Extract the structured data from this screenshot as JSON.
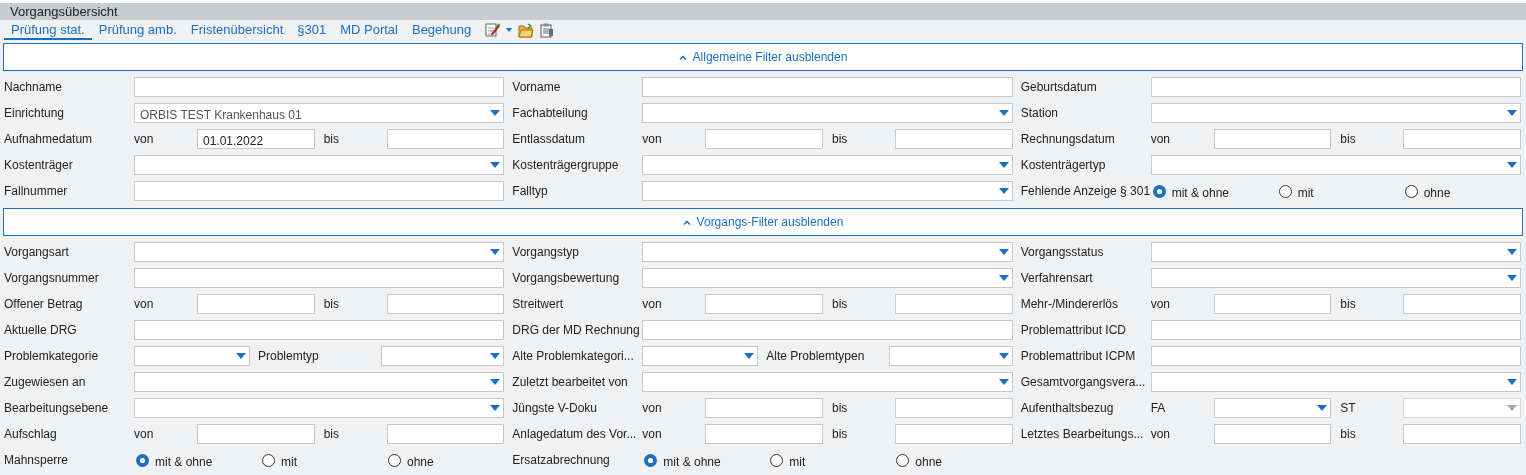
{
  "window": {
    "title": "Vorgangsübersicht"
  },
  "tabs": [
    {
      "label": "Prüfung stat.",
      "selected": true
    },
    {
      "label": "Prüfung amb.",
      "selected": false
    },
    {
      "label": "Fristenübersicht",
      "selected": false
    },
    {
      "label": "§301",
      "selected": false
    },
    {
      "label": "MD Portal",
      "selected": false
    },
    {
      "label": "Begehung",
      "selected": false
    }
  ],
  "sections": [
    {
      "header": "Allgemeine Filter ausblenden",
      "expanded": true,
      "rows": [
        [
          {
            "kind": "single",
            "label": "Nachname",
            "fields": [
              {
                "kind": "text"
              }
            ]
          },
          {
            "kind": "single",
            "label": "Vorname",
            "fields": [
              {
                "kind": "text"
              }
            ]
          },
          {
            "kind": "single",
            "label": "Geburtsdatum",
            "fields": [
              {
                "kind": "text"
              }
            ]
          }
        ],
        [
          {
            "kind": "single",
            "label": "Einrichtung",
            "fields": [
              {
                "kind": "combo",
                "value": "ORBIS TEST Krankenhaus 01"
              }
            ]
          },
          {
            "kind": "single",
            "label": "Fachabteilung",
            "fields": [
              {
                "kind": "combo"
              }
            ]
          },
          {
            "kind": "single",
            "label": "Station",
            "fields": [
              {
                "kind": "combo"
              }
            ]
          }
        ],
        [
          {
            "kind": "range",
            "label": "Aufnahmedatum",
            "fields": [
              {
                "kind": "text",
                "caption": "von",
                "value": "01.01.2022"
              },
              {
                "kind": "text",
                "caption": "bis"
              }
            ]
          },
          {
            "kind": "range",
            "label": "Entlassdatum",
            "fields": [
              {
                "kind": "text",
                "caption": "von"
              },
              {
                "kind": "text",
                "caption": "bis"
              }
            ]
          },
          {
            "kind": "range",
            "label": "Rechnungsdatum",
            "fields": [
              {
                "kind": "text",
                "caption": "von"
              },
              {
                "kind": "text",
                "caption": "bis"
              }
            ]
          }
        ],
        [
          {
            "kind": "single",
            "label": "Kostenträger",
            "fields": [
              {
                "kind": "combo"
              }
            ]
          },
          {
            "kind": "single",
            "label": "Kostenträgergruppe",
            "fields": [
              {
                "kind": "combo"
              }
            ]
          },
          {
            "kind": "single",
            "label": "Kostenträgertyp",
            "fields": [
              {
                "kind": "combo"
              }
            ]
          }
        ],
        [
          {
            "kind": "single",
            "label": "Fallnummer",
            "fields": [
              {
                "kind": "text"
              }
            ]
          },
          {
            "kind": "single",
            "label": "Falltyp",
            "fields": [
              {
                "kind": "combo"
              }
            ]
          },
          {
            "kind": "radio",
            "label": "Fehlende Anzeige § 301",
            "options": [
              {
                "label": "mit & ohne",
                "selected": true
              },
              {
                "label": "mit",
                "selected": false
              },
              {
                "label": "ohne",
                "selected": false
              }
            ]
          }
        ]
      ]
    },
    {
      "header": "Vorgangs-Filter ausblenden",
      "expanded": true,
      "rows": [
        [
          {
            "kind": "single",
            "label": "Vorgangsart",
            "fields": [
              {
                "kind": "combo"
              }
            ]
          },
          {
            "kind": "single",
            "label": "Vorgangstyp",
            "fields": [
              {
                "kind": "combo"
              }
            ]
          },
          {
            "kind": "single",
            "label": "Vorgangsstatus",
            "fields": [
              {
                "kind": "combo"
              }
            ]
          }
        ],
        [
          {
            "kind": "single",
            "label": "Vorgangsnummer",
            "fields": [
              {
                "kind": "text"
              }
            ]
          },
          {
            "kind": "single",
            "label": "Vorgangsbewertung",
            "fields": [
              {
                "kind": "combo"
              }
            ]
          },
          {
            "kind": "single",
            "label": "Verfahrensart",
            "fields": [
              {
                "kind": "combo"
              }
            ]
          }
        ],
        [
          {
            "kind": "range",
            "label": "Offener Betrag",
            "fields": [
              {
                "kind": "text",
                "caption": "von"
              },
              {
                "kind": "text",
                "caption": "bis"
              }
            ]
          },
          {
            "kind": "range",
            "label": "Streitwert",
            "fields": [
              {
                "kind": "text",
                "caption": "von"
              },
              {
                "kind": "text",
                "caption": "bis"
              }
            ]
          },
          {
            "kind": "range",
            "label": "Mehr-/Mindererlös",
            "fields": [
              {
                "kind": "text",
                "caption": "von"
              },
              {
                "kind": "text",
                "caption": "bis"
              }
            ]
          }
        ],
        [
          {
            "kind": "single",
            "label": "Aktuelle DRG",
            "fields": [
              {
                "kind": "text"
              }
            ]
          },
          {
            "kind": "single",
            "label": "DRG der MD Rechnung",
            "fields": [
              {
                "kind": "text"
              }
            ]
          },
          {
            "kind": "single",
            "label": "Problemattribut ICD",
            "fields": [
              {
                "kind": "text"
              }
            ]
          }
        ],
        [
          {
            "kind": "split",
            "label": "Problemkategorie",
            "fields": [
              {
                "kind": "combo"
              },
              {
                "kind": "combo",
                "caption": "Problemtyp"
              }
            ]
          },
          {
            "kind": "split",
            "label": "Alte Problemkategori...",
            "fields": [
              {
                "kind": "combo"
              },
              {
                "kind": "combo",
                "caption": "Alte Problemtypen"
              }
            ]
          },
          {
            "kind": "single",
            "label": "Problemattribut ICPM",
            "fields": [
              {
                "kind": "text"
              }
            ]
          }
        ],
        [
          {
            "kind": "single",
            "label": "Zugewiesen an",
            "fields": [
              {
                "kind": "combo"
              }
            ]
          },
          {
            "kind": "single",
            "label": "Zuletzt bearbeitet von",
            "fields": [
              {
                "kind": "combo"
              }
            ]
          },
          {
            "kind": "single",
            "label": "Gesamtvorgangsvera...",
            "fields": [
              {
                "kind": "combo"
              }
            ]
          }
        ],
        [
          {
            "kind": "single",
            "label": "Bearbeitungsebene",
            "fields": [
              {
                "kind": "combo"
              }
            ]
          },
          {
            "kind": "range",
            "label": "Jüngste V-Doku",
            "fields": [
              {
                "kind": "text",
                "caption": "von"
              },
              {
                "kind": "text",
                "caption": "bis"
              }
            ]
          },
          {
            "kind": "range",
            "label": "Aufenthaltsbezug",
            "fields": [
              {
                "kind": "combo",
                "caption": "FA",
                "disabled": false
              },
              {
                "kind": "combo",
                "caption": "ST",
                "disabled": true
              }
            ]
          }
        ],
        [
          {
            "kind": "range",
            "label": "Aufschlag",
            "fields": [
              {
                "kind": "text",
                "caption": "von"
              },
              {
                "kind": "text",
                "caption": "bis"
              }
            ]
          },
          {
            "kind": "range",
            "label": "Anlagedatum des Vor...",
            "fields": [
              {
                "kind": "text",
                "caption": "von"
              },
              {
                "kind": "text",
                "caption": "bis"
              }
            ]
          },
          {
            "kind": "range",
            "label": "Letztes Bearbeitungs...",
            "fields": [
              {
                "kind": "text",
                "caption": "von"
              },
              {
                "kind": "text",
                "caption": "bis"
              }
            ]
          }
        ],
        [
          {
            "kind": "radio",
            "label": "Mahnsperre",
            "options": [
              {
                "label": "mit & ohne",
                "selected": true
              },
              {
                "label": "mit",
                "selected": false
              },
              {
                "label": "ohne",
                "selected": false
              }
            ]
          },
          {
            "kind": "radio",
            "label": "Ersatzabrechnung",
            "options": [
              {
                "label": "mit & ohne",
                "selected": true
              },
              {
                "label": "mit",
                "selected": false
              },
              {
                "label": "ohne",
                "selected": false
              }
            ]
          },
          {
            "kind": "empty"
          }
        ]
      ]
    }
  ]
}
